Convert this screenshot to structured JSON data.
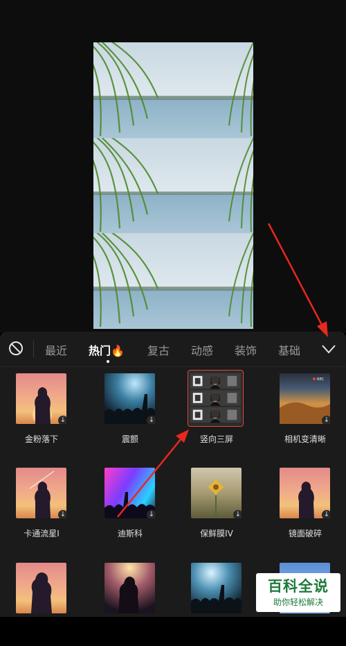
{
  "tabs": [
    {
      "label": "最近"
    },
    {
      "label": "热门🔥"
    },
    {
      "label": "复古"
    },
    {
      "label": "动感"
    },
    {
      "label": "装饰"
    },
    {
      "label": "基础"
    }
  ],
  "active_tab": "热门🔥",
  "effects": [
    {
      "label": "金粉落下",
      "thumb": "sunset"
    },
    {
      "label": "震颤",
      "thumb": "stage"
    },
    {
      "label": "竖向三屏",
      "thumb": "triple",
      "selected": true
    },
    {
      "label": "相机变清晰",
      "thumb": "desert",
      "thumb_text": "REC"
    },
    {
      "label": "卡通流星I",
      "thumb": "sunset"
    },
    {
      "label": "迪斯科",
      "thumb": "disco"
    },
    {
      "label": "保鲜膜IV",
      "thumb": "flower"
    },
    {
      "label": "镜面破碎",
      "thumb": "sunset"
    },
    {
      "label": "",
      "thumb": "sunset"
    },
    {
      "label": "",
      "thumb": "crowd"
    },
    {
      "label": "",
      "thumb": "stage2"
    },
    {
      "label": "",
      "thumb": "sky"
    }
  ],
  "icons": {
    "none": "no-effect-icon",
    "expand": "chevron-down-icon",
    "download": "download-icon"
  },
  "colors": {
    "selected_border": "#e4473b",
    "annotation_arrow": "#e8281e",
    "watermark_green": "#1d7a3c"
  },
  "watermark": {
    "main": "百科全说",
    "sub": "助你轻松解决"
  }
}
